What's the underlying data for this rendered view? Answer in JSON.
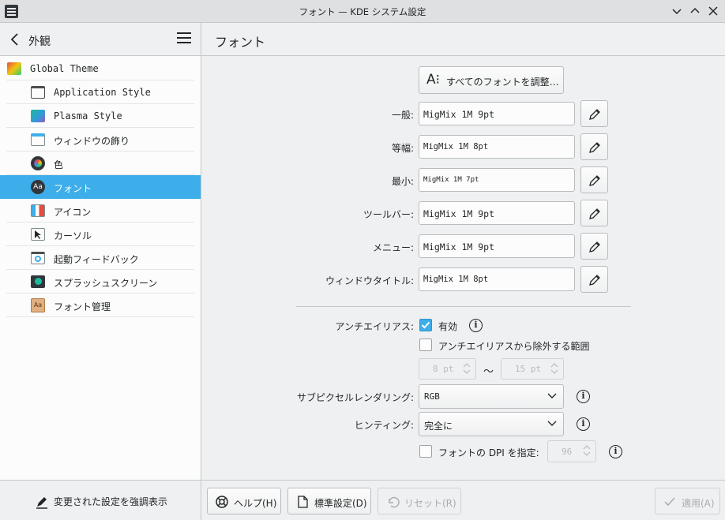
{
  "window": {
    "title": "フォント — KDE システム設定"
  },
  "sidebar": {
    "title": "外観",
    "items": [
      {
        "label": "Global Theme",
        "icon": "global-theme-icon"
      },
      {
        "label": "Application Style",
        "icon": "application-style-icon"
      },
      {
        "label": "Plasma Style",
        "icon": "plasma-style-icon"
      },
      {
        "label": "ウィンドウの飾り",
        "icon": "window-decoration-icon"
      },
      {
        "label": "色",
        "icon": "color-icon"
      },
      {
        "label": "フォント",
        "icon": "font-icon",
        "selected": true
      },
      {
        "label": "アイコン",
        "icon": "icons-icon"
      },
      {
        "label": "カーソル",
        "icon": "cursor-icon"
      },
      {
        "label": "起動フィードバック",
        "icon": "launch-feedback-icon"
      },
      {
        "label": "スプラッシュスクリーン",
        "icon": "splash-screen-icon"
      },
      {
        "label": "フォント管理",
        "icon": "font-management-icon"
      }
    ],
    "highlight_changed": "変更された設定を強調表示"
  },
  "main": {
    "page_title": "フォント",
    "adjust_all": "すべてのフォントを調整…",
    "fonts": [
      {
        "label": "一般:",
        "value": "MigMix 1M 9pt"
      },
      {
        "label": "等幅:",
        "value": "MigMix 1M 8pt"
      },
      {
        "label": "最小:",
        "value": "MigMix 1M 7pt"
      },
      {
        "label": "ツールバー:",
        "value": "MigMix 1M 9pt"
      },
      {
        "label": "メニュー:",
        "value": "MigMix 1M 9pt"
      },
      {
        "label": "ウィンドウタイトル:",
        "value": "MigMix 1M 8pt"
      }
    ],
    "antialias": {
      "label": "アンチエイリアス:",
      "enabled_label": "有効",
      "enabled": true,
      "exclude_label": "アンチエイリアスから除外する範囲",
      "exclude_checked": false,
      "range_from": "8 pt",
      "range_sep": "〜",
      "range_to": "15 pt"
    },
    "subpixel": {
      "label": "サブピクセルレンダリング:",
      "value": "RGB"
    },
    "hinting": {
      "label": "ヒンティング:",
      "value": "完全に"
    },
    "dpi": {
      "label": "フォントの DPI を指定:",
      "checked": false,
      "value": "96"
    }
  },
  "footer": {
    "help": "ヘルプ(H)",
    "defaults": "標準設定(D)",
    "reset": "リセット(R)",
    "apply": "適用(A)"
  },
  "colors": {
    "accent": "#3daee9",
    "window_bg": "#eff0f1",
    "view_bg": "#fcfcfc",
    "text": "#232627"
  }
}
